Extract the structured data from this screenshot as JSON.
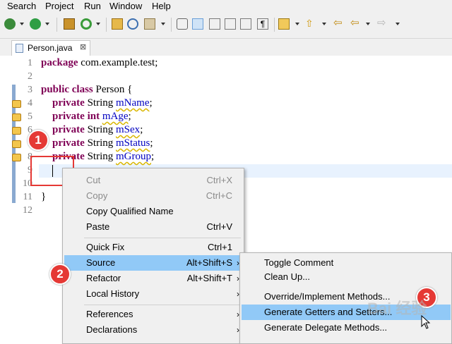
{
  "menubar": {
    "items": [
      "Search",
      "Project",
      "Run",
      "Window",
      "Help"
    ]
  },
  "toolbar": {
    "icons": [
      "debug-icon",
      "run-icon",
      "new-package-icon",
      "refresh-icon",
      "open-folder-icon",
      "search-icon",
      "toggle-mark-occurrences-icon",
      "highlight-icon",
      "show-whitespace-icon",
      "block-selection-icon",
      "pilcrow-icon",
      "next-annotation-icon",
      "prev-annotation-icon",
      "last-edit-icon",
      "back-icon",
      "forward-icon"
    ]
  },
  "editor": {
    "tab": {
      "title": "Person.java",
      "close": "⊠"
    },
    "line_numbers": [
      "1",
      "2",
      "3",
      "4",
      "5",
      "6",
      "7",
      "8",
      "9",
      "10",
      "11",
      "12"
    ],
    "lines": {
      "l1": {
        "kw": "package",
        "rest": " com.example.test;"
      },
      "l3": {
        "kw": "public class",
        "rest": " Person {"
      },
      "l4": {
        "kw": "private",
        "type": " String ",
        "field": "mName",
        "end": ";"
      },
      "l5": {
        "kw": "private int",
        "type": " ",
        "field": "mAge",
        "end": ";"
      },
      "l6": {
        "kw": "private",
        "type": " String ",
        "field": "mSex",
        "end": ";"
      },
      "l7": {
        "kw": "private",
        "type": " String ",
        "field": "mStatus",
        "end": ";"
      },
      "l8": {
        "kw": "private",
        "type": " String ",
        "field": "mGroup",
        "end": ";"
      },
      "l11": {
        "text": "}"
      }
    }
  },
  "context_menu": {
    "items": [
      {
        "label": "Cut",
        "shortcut": "Ctrl+X"
      },
      {
        "label": "Copy",
        "shortcut": "Ctrl+C"
      },
      {
        "label": "Copy Qualified Name",
        "shortcut": ""
      },
      {
        "label": "Paste",
        "shortcut": "Ctrl+V"
      },
      {
        "label": "Quick Fix",
        "shortcut": "Ctrl+1"
      },
      {
        "label": "Source",
        "shortcut": "Alt+Shift+S",
        "submenu": "›"
      },
      {
        "label": "Refactor",
        "shortcut": "Alt+Shift+T",
        "submenu": "›"
      },
      {
        "label": "Local History",
        "shortcut": "",
        "submenu": "›"
      },
      {
        "label": "References",
        "shortcut": "",
        "submenu": "›"
      },
      {
        "label": "Declarations",
        "shortcut": "",
        "submenu": "›"
      }
    ]
  },
  "submenu": {
    "items": [
      {
        "label": "Toggle Comment"
      },
      {
        "label": "Clean Up..."
      },
      {
        "label": "Override/Implement Methods..."
      },
      {
        "label": "Generate Getters and Setters..."
      },
      {
        "label": "Generate Delegate Methods..."
      }
    ]
  },
  "annotations": {
    "badges": [
      "1",
      "2",
      "3"
    ],
    "watermark": "Bai 经验"
  },
  "colors": {
    "keyword": "#7f0055",
    "field": "#0000c0",
    "selection": "#91c9f7",
    "badge": "#e53935"
  }
}
